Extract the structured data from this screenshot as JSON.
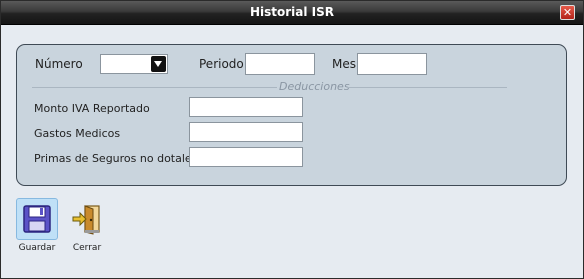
{
  "window": {
    "title": "Historial ISR",
    "close_icon": "close-icon"
  },
  "form": {
    "numero_label": "Número",
    "numero_value": "",
    "periodo_label": "Periodo",
    "periodo_value": "",
    "mes_label": "Mes",
    "mes_value": "",
    "section_title": "Deducciones",
    "monto_iva_label": "Monto IVA Reportado",
    "monto_iva_value": "",
    "gastos_medicos_label": "Gastos Medicos",
    "gastos_medicos_value": "",
    "primas_label": "Primas de Seguros no dotales",
    "primas_value": ""
  },
  "toolbar": {
    "guardar_label": "Guardar",
    "guardar_icon": "floppy-disk-icon",
    "cerrar_label": "Cerrar",
    "cerrar_icon": "exit-door-icon"
  }
}
